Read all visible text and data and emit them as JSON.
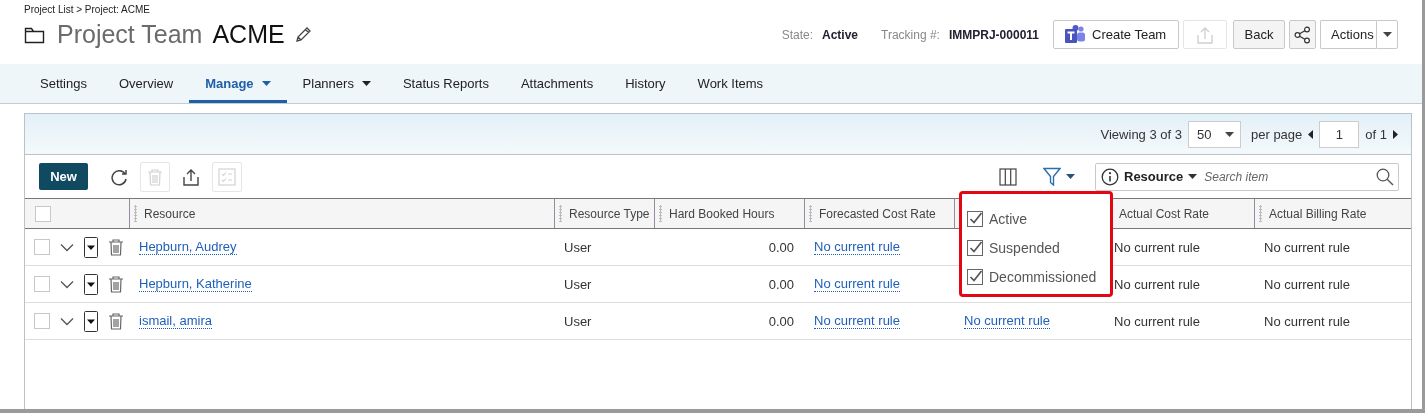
{
  "breadcrumb": "Project List > Project: ACME",
  "title": {
    "type": "Project Team",
    "name": "ACME"
  },
  "state": {
    "label": "State:",
    "value": "Active"
  },
  "tracking": {
    "label": "Tracking #:",
    "value": "IMMPRJ-000011"
  },
  "header_buttons": {
    "create_team": "Create Team",
    "export_disabled": true,
    "back": "Back",
    "menu": "Actions"
  },
  "tabs": [
    {
      "label": "Settings",
      "selected": false,
      "has_menu": false
    },
    {
      "label": "Overview",
      "selected": false,
      "has_menu": false
    },
    {
      "label": "Manage",
      "selected": true,
      "has_menu": true
    },
    {
      "label": "Planners",
      "selected": false,
      "has_menu": true
    },
    {
      "label": "Status Reports",
      "selected": false,
      "has_menu": false
    },
    {
      "label": "Attachments",
      "selected": false,
      "has_menu": false
    },
    {
      "label": "History",
      "selected": false,
      "has_menu": false
    },
    {
      "label": "Work Items",
      "selected": false,
      "has_menu": false
    }
  ],
  "grid": {
    "viewing": "Viewing 3 of 3",
    "page_size": "50",
    "per_page": "per page",
    "page": "1",
    "page_count": "of 1",
    "new_button": "New",
    "tools": [
      {
        "kind": "refresh",
        "disabled": false
      },
      {
        "kind": "delete",
        "disabled": true
      },
      {
        "kind": "export",
        "disabled": false
      },
      {
        "kind": "checklist",
        "disabled": true
      }
    ],
    "search": {
      "scope": "Resource",
      "placeholder": "Search item"
    },
    "select_all": {
      "checked": false
    },
    "columns": [
      "Resource",
      "Resource Type",
      "Hard Booked Hours",
      "Forecasted Cost Rate",
      null,
      "Actual Cost Rate",
      "Actual Billing Rate"
    ],
    "rows": [
      {
        "checked": false,
        "cells": [
          {
            "kind": "link",
            "text": "Hepburn, Audrey"
          },
          {
            "kind": "text",
            "text": "User"
          },
          {
            "kind": "number",
            "text": "0.00"
          },
          {
            "kind": "link",
            "text": "No current rule"
          },
          null,
          {
            "kind": "text",
            "text": "No current rule"
          },
          {
            "kind": "text",
            "text": "No current rule"
          }
        ]
      },
      {
        "checked": false,
        "cells": [
          {
            "kind": "link",
            "text": "Hepburn, Katherine"
          },
          {
            "kind": "text",
            "text": "User"
          },
          {
            "kind": "number",
            "text": "0.00"
          },
          {
            "kind": "link",
            "text": "No current rule"
          },
          null,
          {
            "kind": "text",
            "text": "No current rule"
          },
          {
            "kind": "text",
            "text": "No current rule"
          }
        ]
      },
      {
        "checked": false,
        "cells": [
          {
            "kind": "link",
            "text": "ismail, amira"
          },
          {
            "kind": "text",
            "text": "User"
          },
          {
            "kind": "number",
            "text": "0.00"
          },
          {
            "kind": "link",
            "text": "No current rule"
          },
          {
            "kind": "link",
            "text": "No current rule"
          },
          {
            "kind": "text",
            "text": "No current rule"
          },
          {
            "kind": "text",
            "text": "No current rule"
          }
        ]
      }
    ]
  },
  "status_filter": [
    {
      "label": "Active",
      "checked": true
    },
    {
      "label": "Suspended",
      "checked": true
    },
    {
      "label": "Decommissioned",
      "checked": true
    }
  ]
}
